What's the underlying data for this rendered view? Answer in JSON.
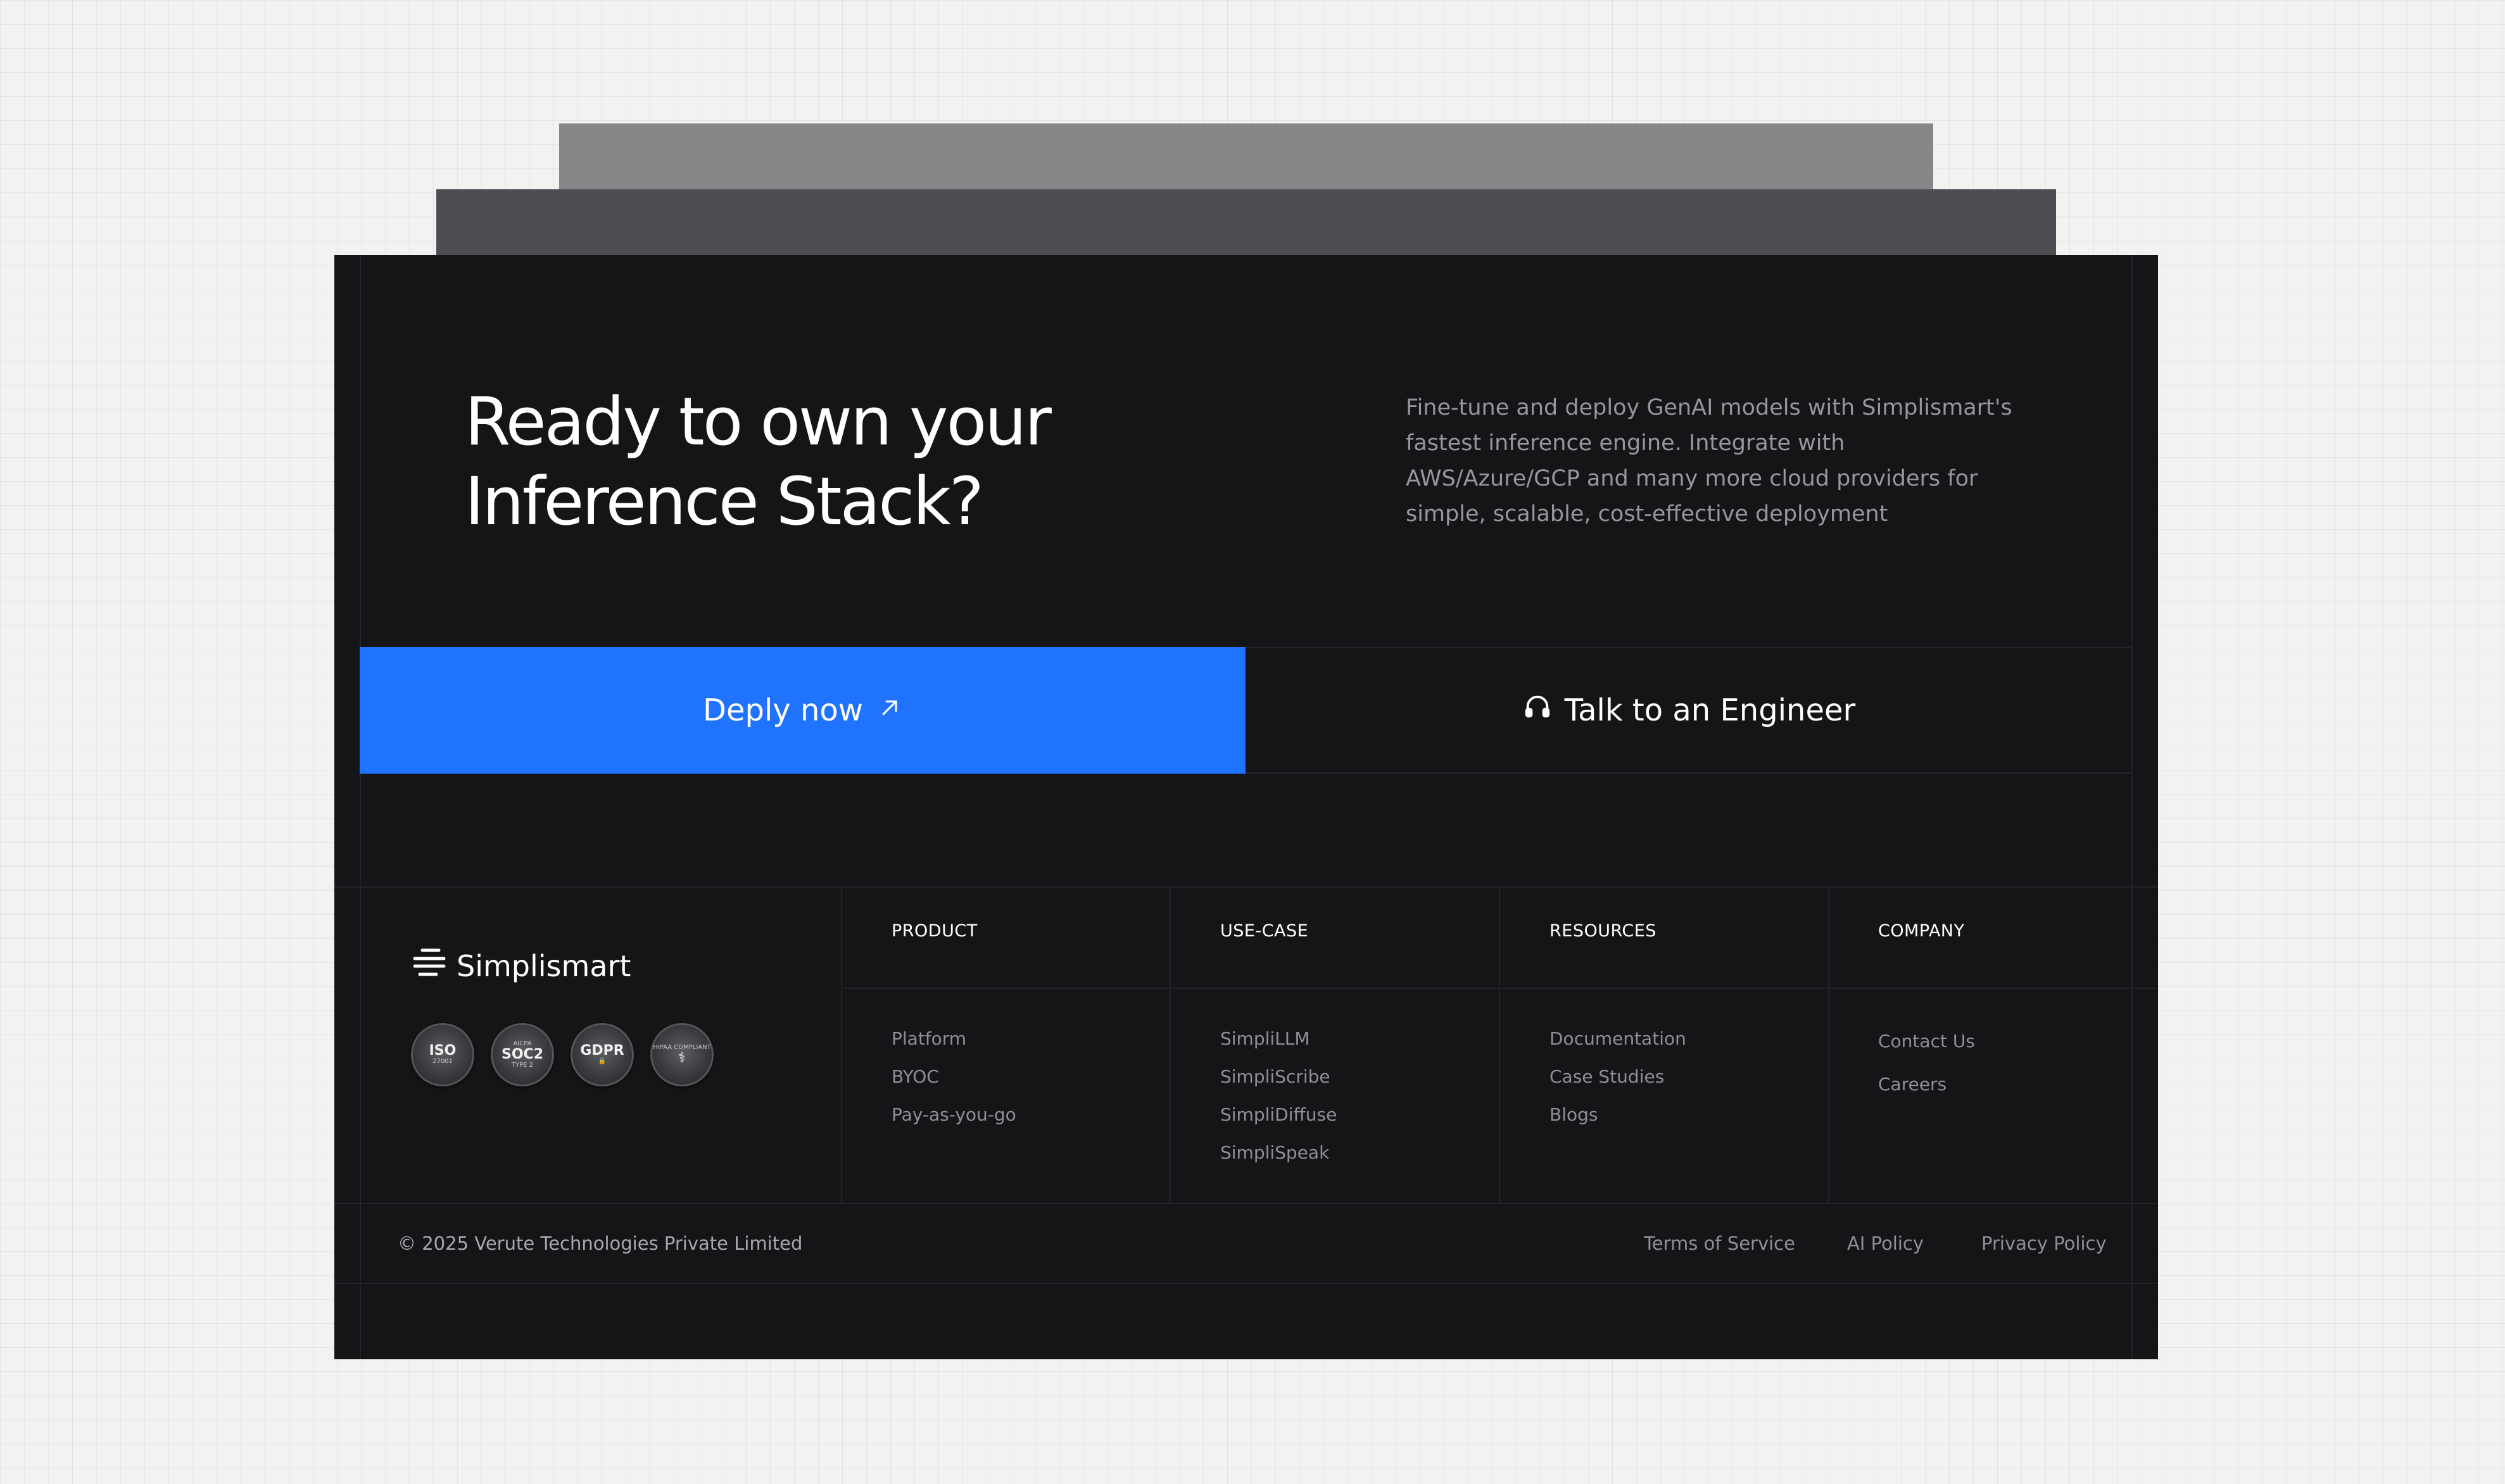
{
  "hero": {
    "title_line1": "Ready to own your",
    "title_line2": "Inference Stack?",
    "description": "Fine-tune and deploy GenAI models with Simplismart's fastest inference engine. Integrate with AWS/Azure/GCP and many more cloud providers for simple, scalable, cost-effective deployment"
  },
  "buttons": {
    "primary_label": "Deply now",
    "primary_icon": "arrow-up-right-icon",
    "secondary_label": "Talk to an Engineer",
    "secondary_icon": "headphones-icon"
  },
  "colors": {
    "accent": "#1f73ff",
    "card_background": "#141517"
  },
  "footer": {
    "brand": "Simplismart",
    "brand_icon": "simplismart-logo-icon",
    "badges": [
      {
        "main": "ISO",
        "sub": "27001"
      },
      {
        "top": "AICPA",
        "main": "SOC2",
        "sub": "TYPE 2"
      },
      {
        "main": "GDPR",
        "sub": "🔒"
      },
      {
        "top": "HIPAA COMPLIANT",
        "main": "⚕",
        "sub": ""
      }
    ],
    "columns": {
      "product": {
        "heading": "PRODUCT",
        "items": [
          "Platform",
          "BYOC",
          "Pay-as-you-go"
        ]
      },
      "usecase": {
        "heading": "USE-CASE",
        "items": [
          "SimpliLLM",
          "SimpliScribe",
          "SimpliDiffuse",
          "SimpliSpeak"
        ]
      },
      "resources": {
        "heading": "RESOURCES",
        "items": [
          "Documentation",
          "Case Studies",
          "Blogs"
        ]
      },
      "company": {
        "heading": "COMPANY",
        "items": [
          "Contact Us",
          "Careers"
        ]
      }
    },
    "copyright": "© 2025 Verute Technologies Private Limited",
    "legal": {
      "terms": "Terms of Service",
      "ai_policy": "AI Policy",
      "privacy": "Privacy Policy"
    }
  }
}
